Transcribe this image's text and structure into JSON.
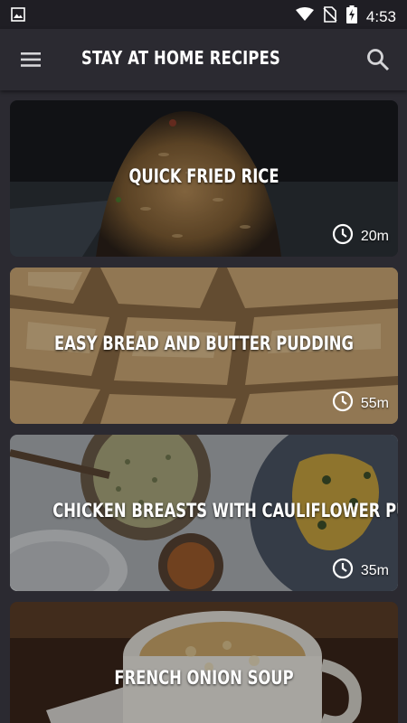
{
  "status_bar": {
    "time": "4:53"
  },
  "toolbar": {
    "title": "STAY AT HOME RECIPES"
  },
  "recipes": [
    {
      "name": "QUICK FRIED RICE",
      "time": "20m"
    },
    {
      "name": "EASY BREAD AND BUTTER PUDDING",
      "time": "55m"
    },
    {
      "name": "CHICKEN BREASTS WITH CAULIFLOWER PUREE",
      "time": "35m"
    },
    {
      "name": "FRENCH ONION SOUP",
      "time": ""
    }
  ],
  "icons": {
    "menu": "hamburger-menu-icon",
    "search": "search-icon",
    "clock": "clock-icon"
  },
  "colors": {
    "background": "#2b2a31",
    "status_bar": "#1f1e24",
    "text": "#ffffff"
  }
}
